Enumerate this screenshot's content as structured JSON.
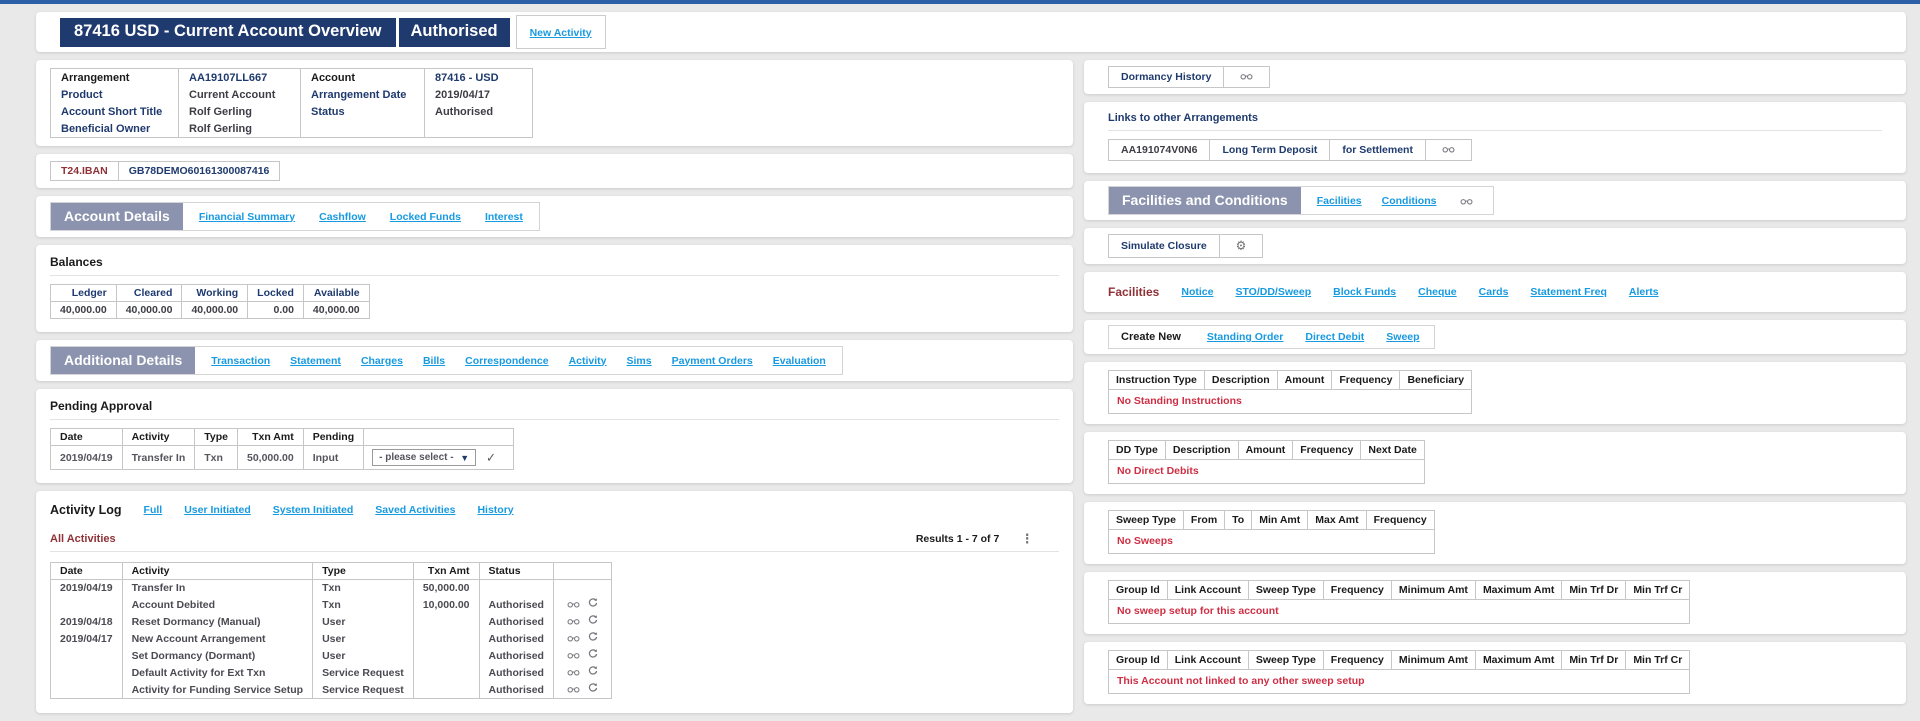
{
  "header": {
    "title": "87416 USD - Current Account Overview",
    "status_badge": "Authorised",
    "new_activity_label": "New Activity"
  },
  "arrangement_panel": {
    "rows": [
      {
        "c0": "Arrangement",
        "c1": "AA19107LL667",
        "c2": "Account",
        "c3": "87416 - USD"
      },
      {
        "c0": "Product",
        "c1": "Current Account",
        "c2": "Arrangement Date",
        "c3": "2019/04/17"
      },
      {
        "c0": "Account Short Title",
        "c1": "Rolf Gerling",
        "c2": "Status",
        "c3": "Authorised"
      },
      {
        "c0": "Beneficial Owner",
        "c1": "Rolf Gerling",
        "c2": "",
        "c3": ""
      }
    ]
  },
  "iban_panel": {
    "label": "T24.IBAN",
    "value": "GB78DEMO60161300087416"
  },
  "account_details": {
    "title": "Account Details",
    "tabs": [
      "Financial Summary",
      "Cashflow",
      "Locked Funds",
      "Interest"
    ]
  },
  "balances": {
    "title": "Balances",
    "headers": [
      "Ledger",
      "Cleared",
      "Working",
      "Locked",
      "Available"
    ],
    "values": [
      "40,000.00",
      "40,000.00",
      "40,000.00",
      "0.00",
      "40,000.00"
    ]
  },
  "additional_details": {
    "title": "Additional Details",
    "tabs": [
      "Transaction",
      "Statement",
      "Charges",
      "Bills",
      "Correspondence",
      "Activity",
      "Sims",
      "Payment Orders",
      "Evaluation"
    ]
  },
  "pending_approval": {
    "title": "Pending Approval",
    "headers": [
      "Date",
      "Activity",
      "Type",
      "Txn Amt",
      "Pending"
    ],
    "row": {
      "date": "2019/04/19",
      "activity": "Transfer In",
      "type": "Txn",
      "txn_amt": "50,000.00",
      "pending": "Input",
      "select_placeholder": "- please select -"
    }
  },
  "activity_log": {
    "title": "Activity Log",
    "tabs": [
      "Full",
      "User Initiated",
      "System Initiated",
      "Saved Activities",
      "History"
    ],
    "filter_label": "All Activities",
    "results": "Results 1 - 7 of 7",
    "headers": [
      "Date",
      "Activity",
      "Type",
      "Txn Amt",
      "Status"
    ],
    "rows": [
      {
        "date": "2019/04/19",
        "activity": "Transfer In",
        "type": "Txn",
        "txn_amt": "50,000.00",
        "status": ""
      },
      {
        "date": "",
        "activity": "Account Debited",
        "type": "Txn",
        "txn_amt": "10,000.00",
        "status": "Authorised"
      },
      {
        "date": "2019/04/18",
        "activity": "Reset Dormancy (Manual)",
        "type": "User",
        "txn_amt": "",
        "status": "Authorised"
      },
      {
        "date": "2019/04/17",
        "activity": "New Account Arrangement",
        "type": "User",
        "txn_amt": "",
        "status": "Authorised"
      },
      {
        "date": "",
        "activity": "Set Dormancy (Dormant)",
        "type": "User",
        "txn_amt": "",
        "status": "Authorised"
      },
      {
        "date": "",
        "activity": "Default Activity for Ext Txn",
        "type": "Service Request",
        "txn_amt": "",
        "status": "Authorised"
      },
      {
        "date": "",
        "activity": "Activity for Funding Service Setup",
        "type": "Service Request",
        "txn_amt": "",
        "status": "Authorised"
      }
    ]
  },
  "dormancy": {
    "label": "Dormancy History"
  },
  "links_arrangements": {
    "title": "Links to other Arrangements",
    "row": {
      "id": "AA191074V0N6",
      "product": "Long Term Deposit",
      "purpose": "for Settlement"
    }
  },
  "facilities_conditions": {
    "title": "Facilities and Conditions",
    "tabs": [
      "Facilities",
      "Conditions"
    ]
  },
  "simulate": {
    "label": "Simulate Closure"
  },
  "facilities": {
    "title": "Facilities",
    "tabs": [
      "Notice",
      "STO/DD/Sweep",
      "Block Funds",
      "Cheque",
      "Cards",
      "Statement Freq",
      "Alerts"
    ]
  },
  "create_new": {
    "label": "Create New",
    "tabs": [
      "Standing Order",
      "Direct Debit",
      "Sweep"
    ]
  },
  "standing_orders": {
    "headers": [
      "Instruction Type",
      "Description",
      "Amount",
      "Frequency",
      "Beneficiary"
    ],
    "empty": "No Standing Instructions"
  },
  "direct_debits": {
    "headers": [
      "DD Type",
      "Description",
      "Amount",
      "Frequency",
      "Next Date"
    ],
    "empty": "No Direct Debits"
  },
  "sweeps": {
    "headers": [
      "Sweep Type",
      "From",
      "To",
      "Min Amt",
      "Max Amt",
      "Frequency"
    ],
    "empty": "No Sweeps"
  },
  "sweep_group": {
    "headers": [
      "Group Id",
      "Link Account",
      "Sweep Type",
      "Frequency",
      "Minimum Amt",
      "Maximum Amt",
      "Min Trf Dr",
      "Min Trf Cr"
    ],
    "empty": "No sweep setup for this account"
  },
  "sweep_group_linked": {
    "headers": [
      "Group Id",
      "Link Account",
      "Sweep Type",
      "Frequency",
      "Minimum Amt",
      "Maximum Amt",
      "Min Trf Dr",
      "Min Trf Cr"
    ],
    "empty": "This Account not linked to any other sweep setup"
  },
  "icons": {
    "gear": "⚙",
    "kebab": "⋮",
    "check": "✓",
    "dropdown_arrow": "▼"
  },
  "colors": {
    "accent_navy": "#1f3a6e",
    "link_blue": "#189ae0",
    "slate_header": "#8b93ae",
    "maroon_heading": "#8f3237",
    "alert_red": "#ce2f44",
    "topbar_blue": "#2c5fa5"
  }
}
